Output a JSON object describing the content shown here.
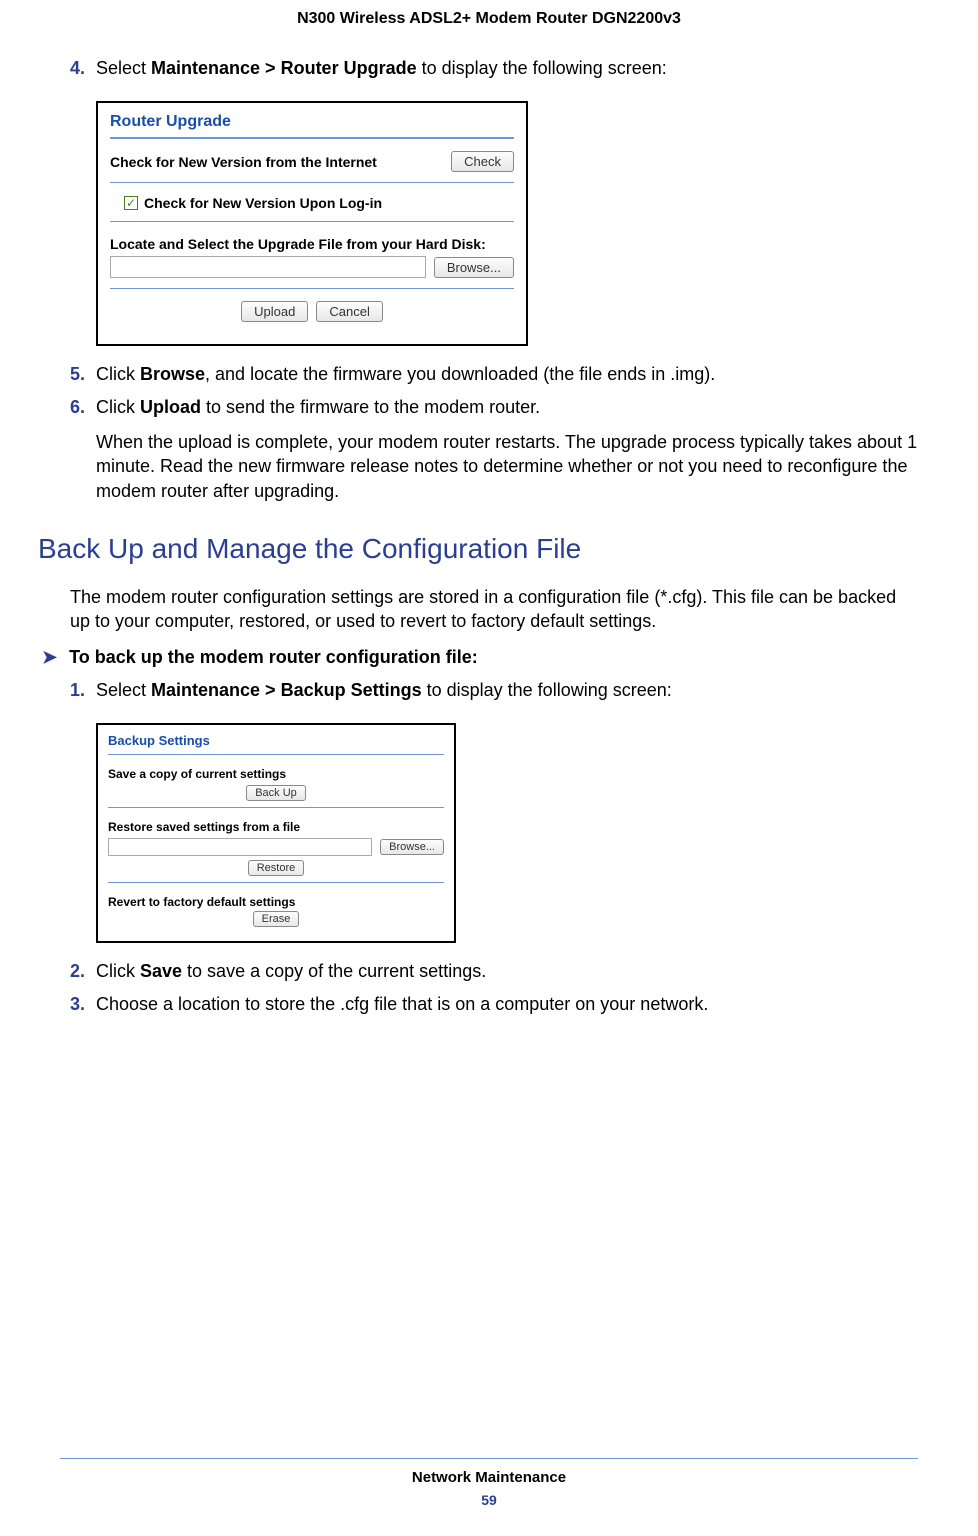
{
  "header": {
    "title": "N300 Wireless ADSL2+ Modem Router DGN2200v3"
  },
  "steps_a": {
    "s4": {
      "num": "4.",
      "text_before": "Select ",
      "bold": "Maintenance > Router Upgrade",
      "text_after": " to display the following screen:"
    },
    "s5": {
      "num": "5.",
      "text_before": "Click ",
      "bold": "Browse",
      "text_after": ", and locate the firmware you downloaded (the file ends in .img)."
    },
    "s6": {
      "num": "6.",
      "text_before": "Click ",
      "bold": "Upload",
      "text_after": " to send the firmware to the modem router.",
      "para": "When the upload is complete, your modem router restarts. The upgrade process typically takes about 1 minute. Read the new firmware release notes to determine whether or not you need to reconfigure the modem router after upgrading."
    }
  },
  "router_panel": {
    "title": "Router Upgrade",
    "check_label": "Check for New Version from the Internet",
    "check_btn": "Check",
    "chk_label": "Check for New Version Upon Log-in",
    "locate_label": "Locate and Select the Upgrade File from your Hard Disk:",
    "browse_btn": "Browse...",
    "upload_btn": "Upload",
    "cancel_btn": "Cancel"
  },
  "section": {
    "heading": "Back Up and Manage the Configuration File",
    "intro": "The modem router configuration settings are stored in a configuration file (*.cfg). This file can be backed up to your computer, restored, or used to revert to factory default settings.",
    "task": "To back up the modem router configuration file:"
  },
  "steps_b": {
    "s1": {
      "num": "1.",
      "text_before": "Select ",
      "bold": "Maintenance > Backup Settings",
      "text_after": " to display the following screen:"
    },
    "s2": {
      "num": "2.",
      "text_before": "Click ",
      "bold": "Save",
      "text_after": " to save a copy of the current settings."
    },
    "s3": {
      "num": "3.",
      "text": "Choose a location to store the .cfg file that is on a computer on your network."
    }
  },
  "backup_panel": {
    "title": "Backup Settings",
    "save_label": "Save a copy of current settings",
    "backup_btn": "Back Up",
    "restore_label": "Restore saved settings from a file",
    "browse_btn": "Browse...",
    "restore_btn": "Restore",
    "revert_label": "Revert to factory default settings",
    "erase_btn": "Erase"
  },
  "footer": {
    "section": "Network Maintenance",
    "page": "59"
  }
}
